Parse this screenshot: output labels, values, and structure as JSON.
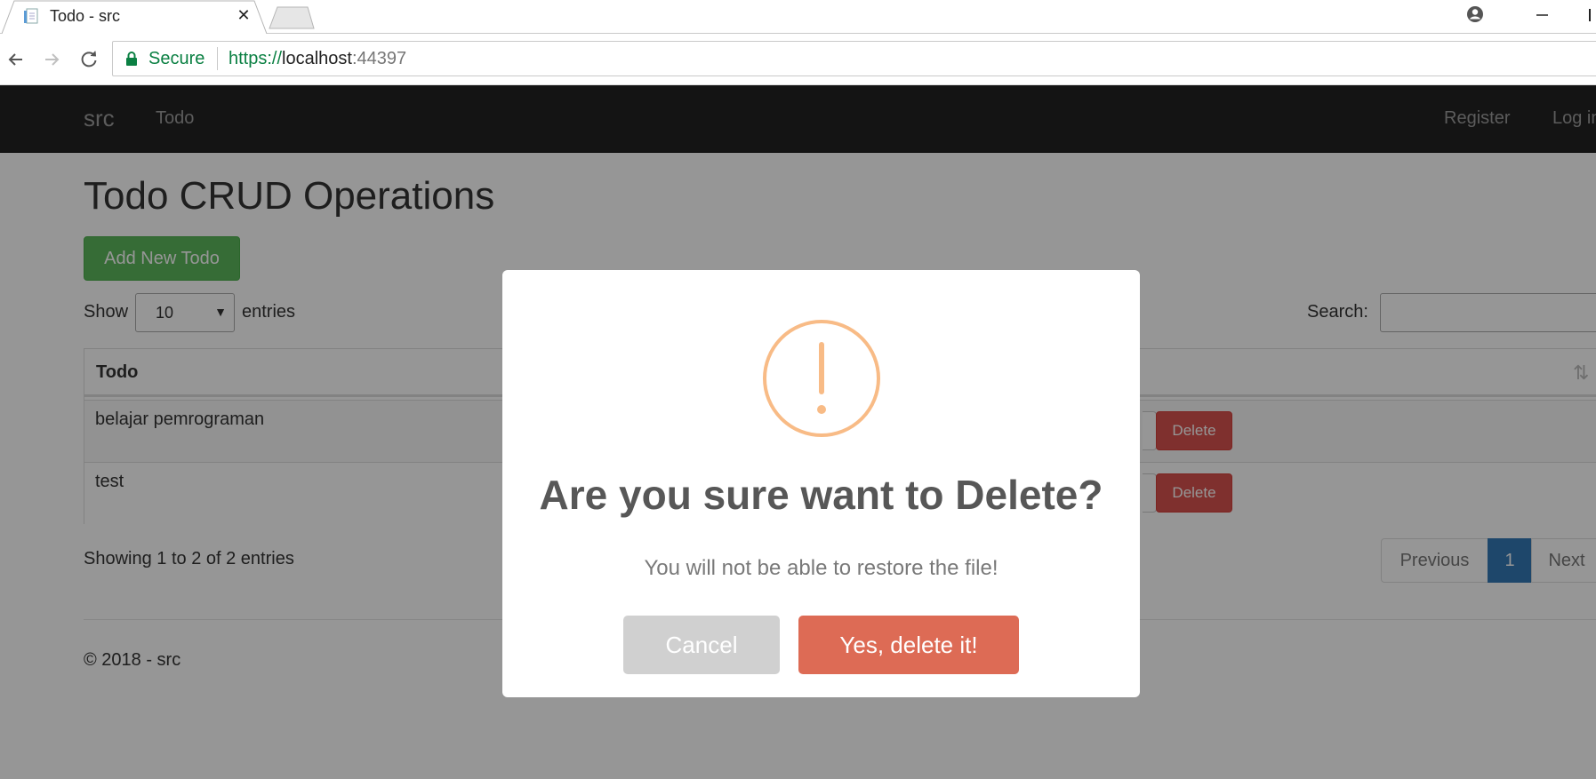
{
  "browser": {
    "tab_title": "Todo - src",
    "tab_close": "✕",
    "secure_label": "Secure",
    "url_scheme": "https://",
    "url_host": "localhost",
    "url_port": ":44397"
  },
  "navbar": {
    "brand": "src",
    "links": [
      "Todo"
    ],
    "right_links": [
      "Register",
      "Log in"
    ]
  },
  "main": {
    "title": "Todo CRUD Operations",
    "add_button": "Add New Todo",
    "show_label": "Show",
    "entries_value": "10",
    "entries_label": "entries",
    "search_label": "Search:",
    "search_value": "",
    "table": {
      "header": "Todo",
      "rows": [
        {
          "todo": "belajar pemrograman",
          "delete": "Delete"
        },
        {
          "todo": "test",
          "delete": "Delete"
        }
      ]
    },
    "info": "Showing 1 to 2 of 2 entries",
    "pagination": {
      "previous": "Previous",
      "current": "1",
      "next": "Next"
    }
  },
  "footer": {
    "text": "© 2018 - src"
  },
  "modal": {
    "title": "Are you sure want to Delete?",
    "text": "You will not be able to restore the file!",
    "cancel": "Cancel",
    "confirm": "Yes, delete it!",
    "icon": "exclamation-circle-icon"
  },
  "colors": {
    "navbar": "#222222",
    "add_button": "#5cb85c",
    "delete_button": "#d9534f",
    "page_active": "#337ab7",
    "warning": "#f8bb86",
    "confirm_button": "#dd6b55",
    "cancel_button": "#d0d0d0",
    "secure": "#0b8043"
  }
}
